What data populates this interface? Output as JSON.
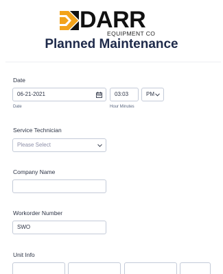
{
  "header": {
    "logo_word": "DARR",
    "logo_sub": "EQUIPMENT CO",
    "title": "Planned Maintenance"
  },
  "colors": {
    "logo_orange": "#f2a31b",
    "title": "#1e2a4a",
    "border": "#c3cad8"
  },
  "form": {
    "date": {
      "label": "Date",
      "date_value": "06-21-2021",
      "date_sublabel": "Date",
      "time_value": "03:03",
      "time_sublabel": "Hour Minutes",
      "ampm_value": "PM",
      "calendar_icon": "calendar-icon"
    },
    "technician": {
      "label": "Service Technician",
      "placeholder": "Please Select"
    },
    "company": {
      "label": "Company Name",
      "value": ""
    },
    "workorder": {
      "label": "Workorder Number",
      "value": "SWO"
    },
    "unit_info": {
      "label": "Unit Info"
    }
  }
}
